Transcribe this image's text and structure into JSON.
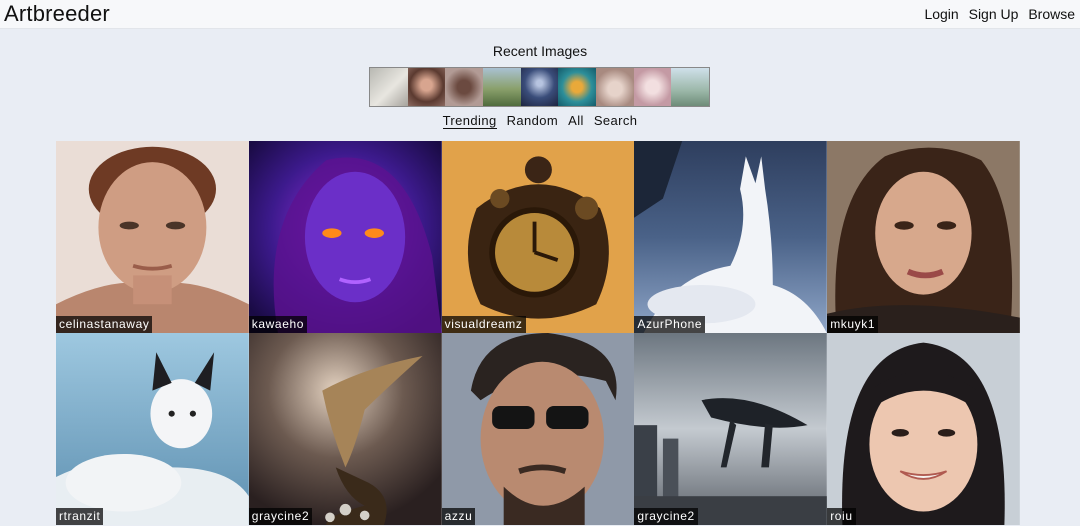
{
  "app": {
    "title": "Artbreeder"
  },
  "nav": {
    "login": "Login",
    "signup": "Sign Up",
    "browse": "Browse"
  },
  "recent": {
    "title": "Recent Images",
    "thumbs": [
      "#c9c8c4",
      "#8a5f55",
      "#9a7d78",
      "#6f8a5a",
      "#3a4d7a",
      "#2d8f9a",
      "#c9aea6",
      "#d9b2b9",
      "#a7c4c9"
    ]
  },
  "tabs": {
    "trending": "Trending",
    "random": "Random",
    "all": "All",
    "search": "Search"
  },
  "tiles": [
    {
      "user": "celinastanaway"
    },
    {
      "user": "kawaeho"
    },
    {
      "user": "visualdreamz"
    },
    {
      "user": "AzurPhone"
    },
    {
      "user": "mkuyk1"
    },
    {
      "user": "rtranzit"
    },
    {
      "user": "graycine2"
    },
    {
      "user": "azzu"
    },
    {
      "user": "graycine2"
    },
    {
      "user": "roiu"
    }
  ]
}
